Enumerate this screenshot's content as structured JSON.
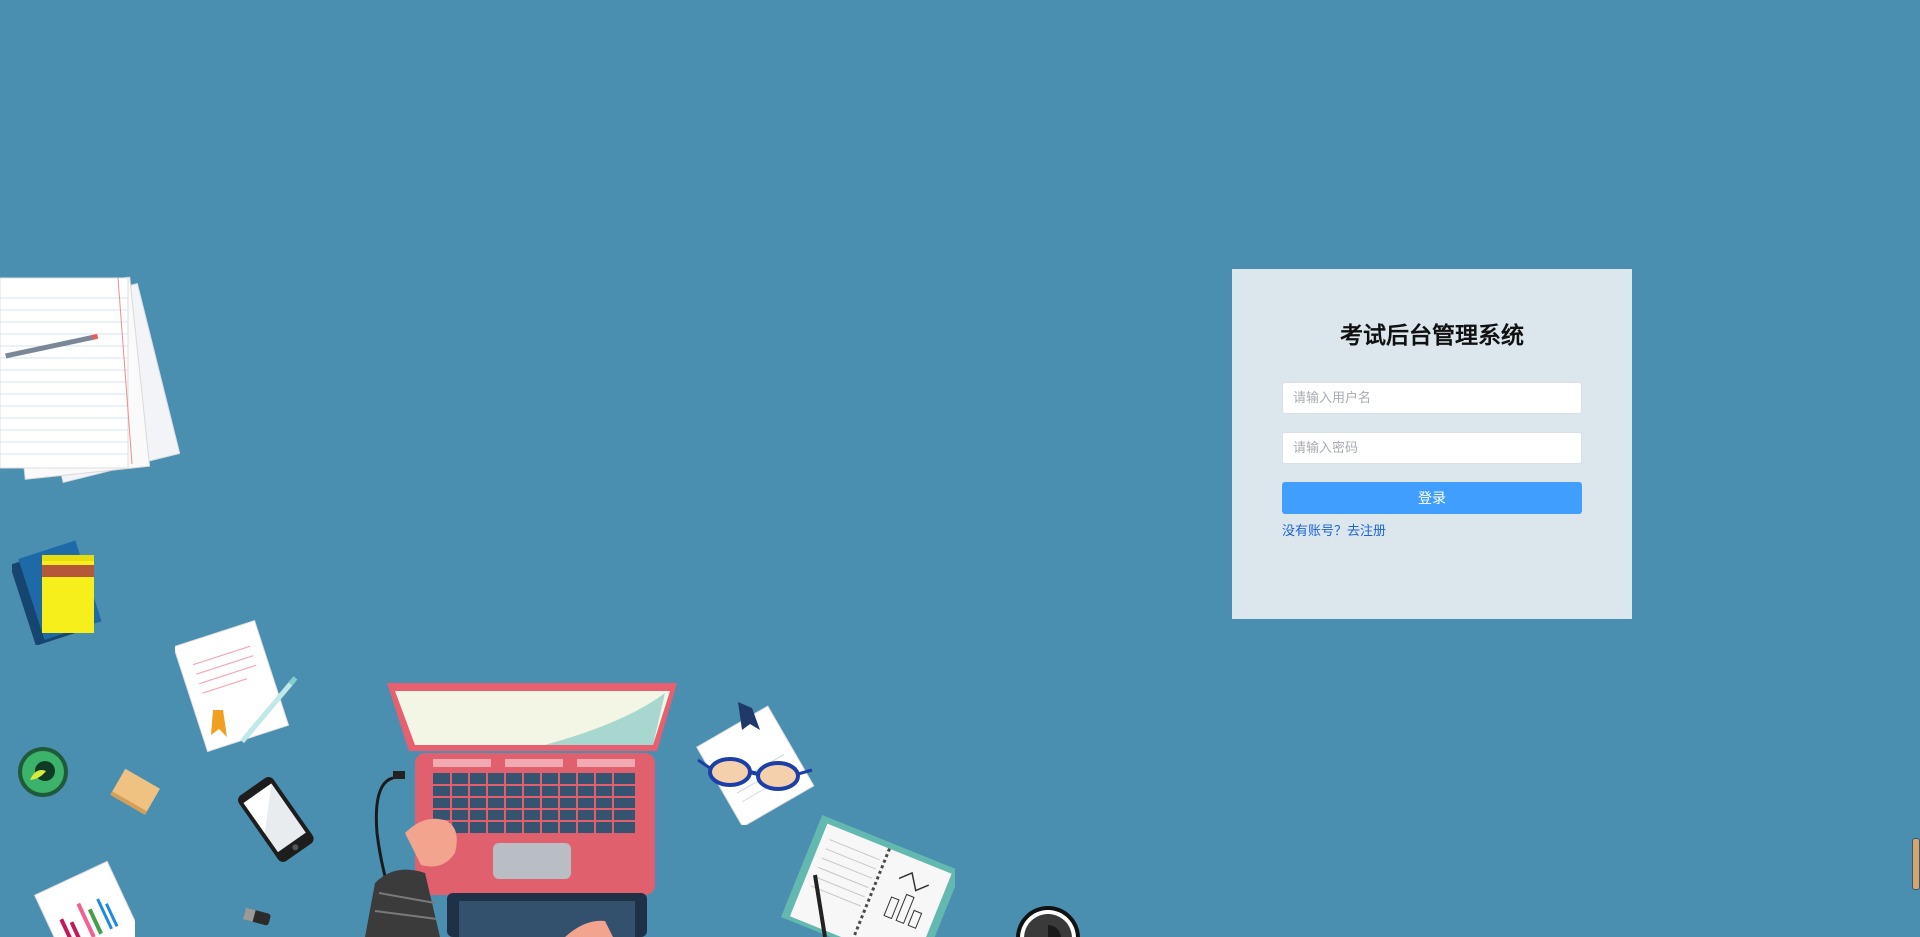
{
  "login": {
    "title": "考试后台管理系统",
    "username_placeholder": "请输入用户名",
    "password_placeholder": "请输入密码",
    "submit_label": "登录",
    "register_text": "没有账号？去注册"
  },
  "colors": {
    "background": "#4a8fb0",
    "panel": "#dbe7ec",
    "primary_button": "#409eff",
    "link": "#1f63d6"
  },
  "decorations": [
    "paper-stack-icon",
    "sticky-notes-icon",
    "document-with-pen-icon",
    "badge-icon",
    "eraser-icon",
    "smartphone-icon",
    "laptop-icon",
    "glasses-on-paper-icon",
    "notebook-icon",
    "coffee-cup-icon",
    "chart-paper-icon",
    "usb-drive-icon"
  ]
}
